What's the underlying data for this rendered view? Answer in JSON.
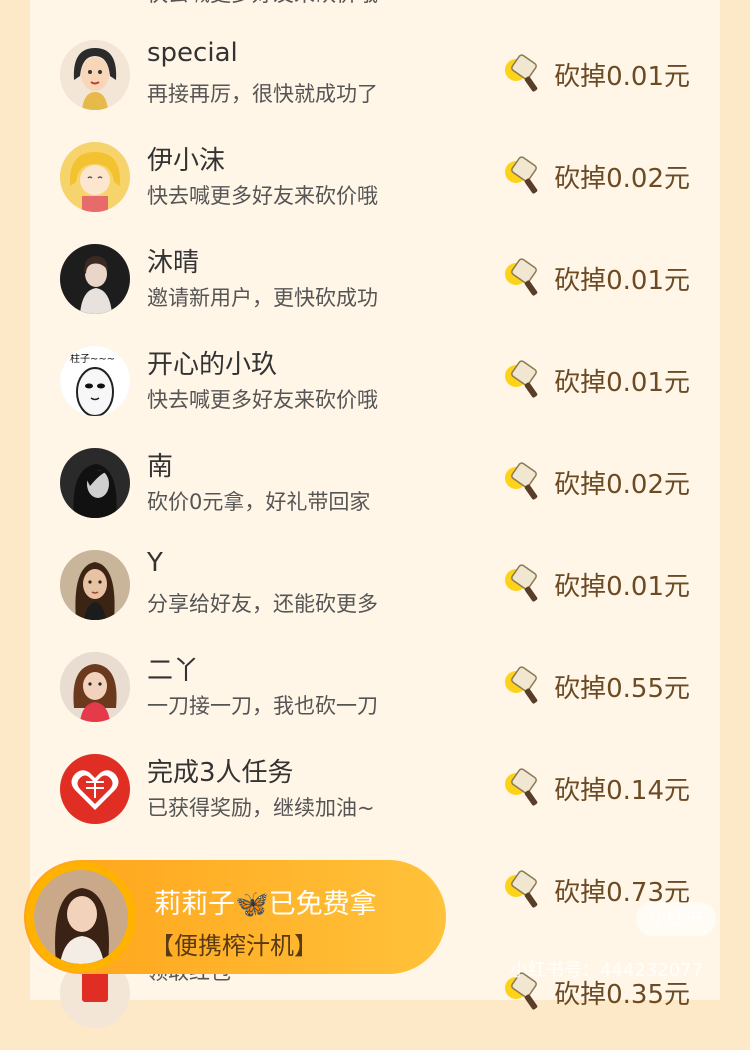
{
  "top_partial": {
    "msg": "快去喊更多好友来砍价哦"
  },
  "rows": [
    {
      "name": "special",
      "msg": "再接再厉，很快就成功了",
      "amount": "砍掉0.01元",
      "avatar": "avatar-cartoon-princess"
    },
    {
      "name": "伊小沫",
      "msg": "快去喊更多好友来砍价哦",
      "amount": "砍掉0.02元",
      "avatar": "avatar-cartoon-girl-yellow"
    },
    {
      "name": "沐晴",
      "msg": "邀请新用户，更快砍成功",
      "amount": "砍掉0.01元",
      "avatar": "avatar-photo-girl"
    },
    {
      "name": "开心的小玖",
      "msg": "快去喊更多好友来砍价哦",
      "amount": "砍掉0.01元",
      "avatar": "avatar-meme-face"
    },
    {
      "name": "南",
      "msg": "砍价0元拿，好礼带回家",
      "amount": "砍掉0.02元",
      "avatar": "avatar-photo-dark"
    },
    {
      "name": "Y",
      "msg": "分享给好友，还能砍更多",
      "amount": "砍掉0.01元",
      "avatar": "avatar-photo-woman"
    },
    {
      "name": "二丫",
      "msg": "一刀接一刀，我也砍一刀",
      "amount": "砍掉0.55元",
      "avatar": "avatar-photo-girl-red"
    },
    {
      "name": "完成3人任务",
      "msg": "已获得奖励，继续加油~",
      "amount": "砍掉0.14元",
      "avatar": "pinduoduo-logo"
    }
  ],
  "hidden_row": {
    "amount": "砍掉0.73元"
  },
  "bottom_partial": {
    "msg": "领取红包",
    "amount": "砍掉0.35元"
  },
  "banner": {
    "line1": "莉莉子🦋已免费拿",
    "line2": "【便携榨汁机】"
  },
  "watermark": {
    "badge": "小红书",
    "text": "小红书号：444232077"
  },
  "colors": {
    "page_bg": "#fde9c8",
    "panel_bg": "#fff6e8",
    "banner_start": "#ffa31a",
    "banner_end": "#ffc23a",
    "amount_text": "#6b4a24"
  }
}
